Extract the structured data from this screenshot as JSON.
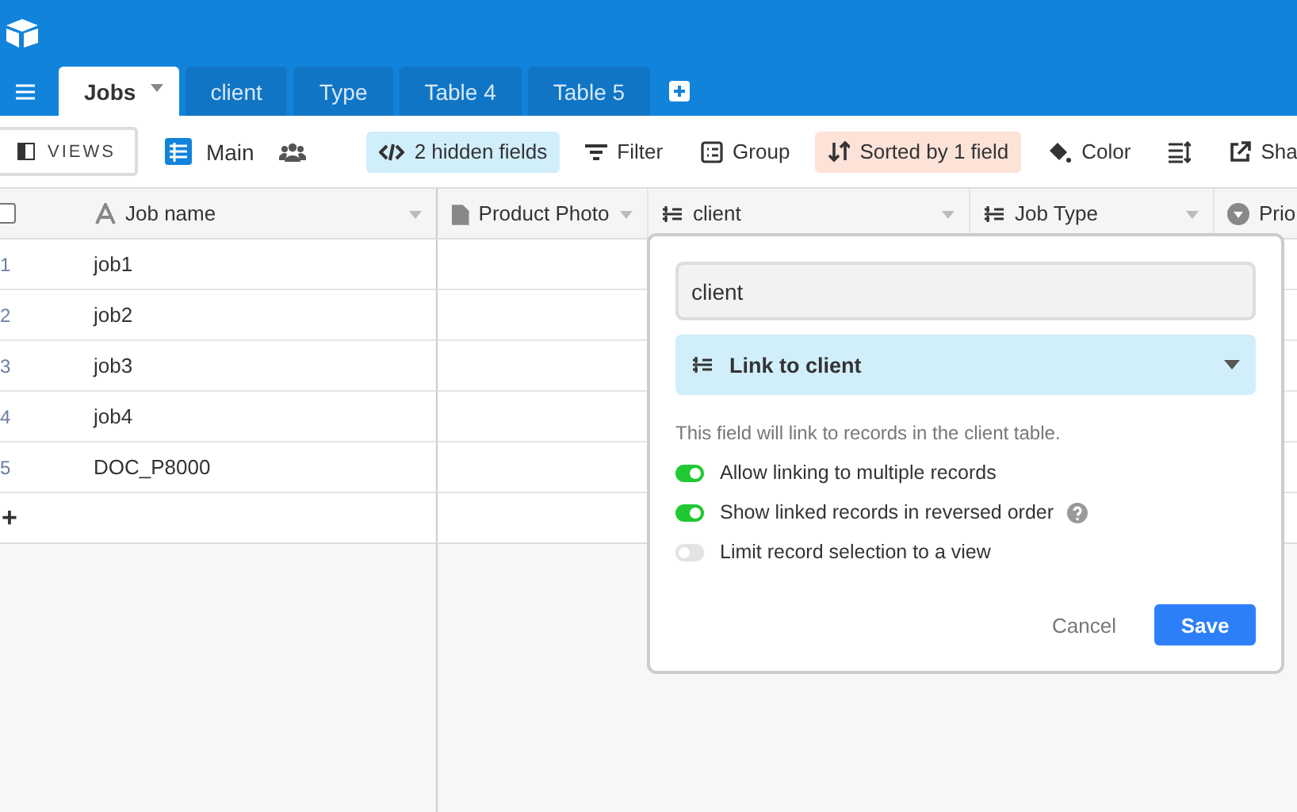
{
  "tabs": [
    {
      "label": "Jobs",
      "selected": true
    },
    {
      "label": "client",
      "selected": false
    },
    {
      "label": "Type",
      "selected": false
    },
    {
      "label": "Table 4",
      "selected": false
    },
    {
      "label": "Table 5",
      "selected": false
    }
  ],
  "toolbar": {
    "views_button": "VIEWS",
    "view_name": "Main",
    "items": [
      {
        "kind": "hidden",
        "label": "2 hidden fields",
        "active": true
      },
      {
        "kind": "filter",
        "label": "Filter",
        "active": false
      },
      {
        "kind": "group",
        "label": "Group",
        "active": false
      },
      {
        "kind": "sort",
        "label": "Sorted by 1 field",
        "active": true
      },
      {
        "kind": "color",
        "label": "Color",
        "active": false
      },
      {
        "kind": "rowheight",
        "active": false
      },
      {
        "kind": "share",
        "label": "Sha",
        "active": false
      }
    ]
  },
  "columns": [
    {
      "kind": "text",
      "name": "Job name"
    },
    {
      "kind": "attachment",
      "name": "Product Photo"
    },
    {
      "kind": "link",
      "name": "client"
    },
    {
      "kind": "link",
      "name": "Job Type"
    },
    {
      "kind": "select",
      "name": "Prio"
    }
  ],
  "select_all_checked": false,
  "rows": [
    {
      "number": "1",
      "job_name": "job1"
    },
    {
      "number": "2",
      "job_name": "job2"
    },
    {
      "number": "3",
      "job_name": "job3"
    },
    {
      "number": "4",
      "job_name": "job4"
    },
    {
      "number": "5",
      "job_name": "DOC_P8000"
    }
  ],
  "add_row": "+",
  "field_editor": {
    "field_name": "client",
    "field_type": "Link to client",
    "description": "This field will link to records in the client table.",
    "options": [
      {
        "label": "Allow linking to multiple records",
        "on": true,
        "help": false
      },
      {
        "label": "Show linked records in reversed order",
        "on": true,
        "help": true
      },
      {
        "label": "Limit record selection to a view",
        "on": false,
        "help": false
      }
    ],
    "cancel": "Cancel",
    "save": "Save"
  }
}
